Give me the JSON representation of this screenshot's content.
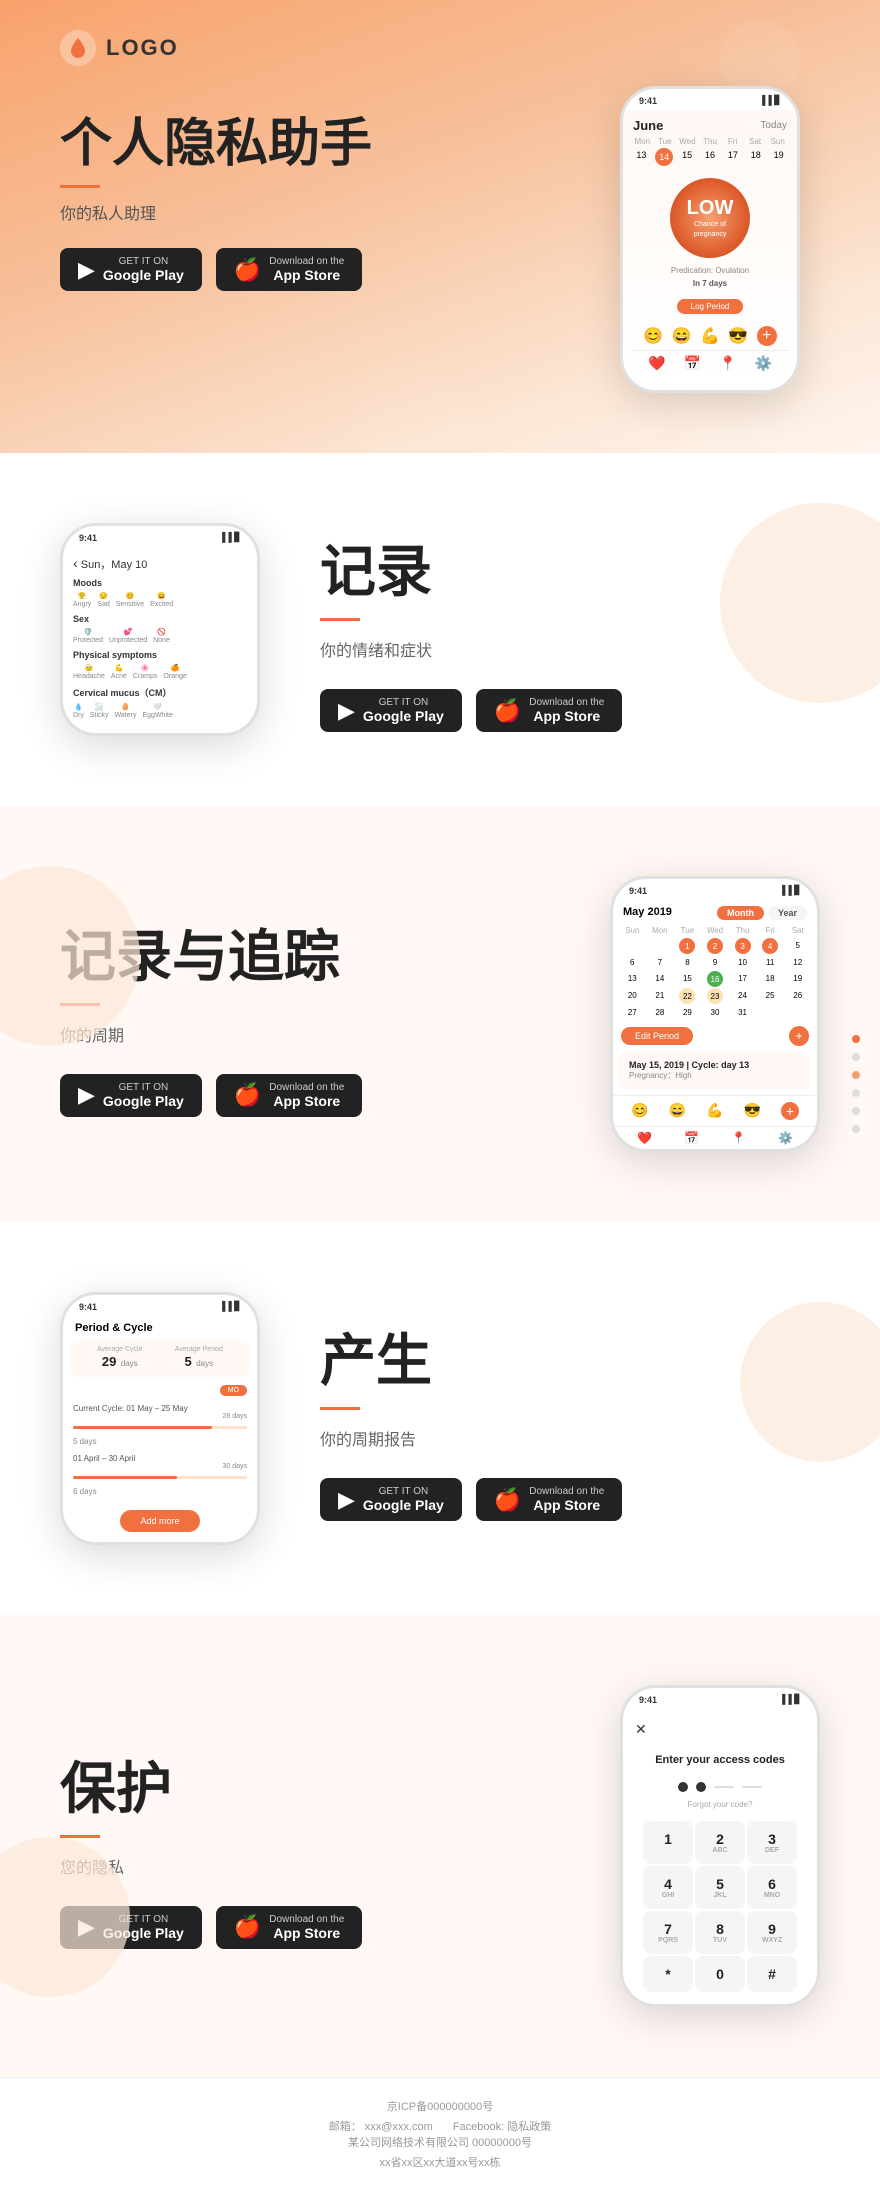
{
  "logo": {
    "text": "LOGO"
  },
  "hero": {
    "title": "个人隐私助手",
    "subtitle": "你的私人助理",
    "google_play_label_small": "GET IT ON",
    "google_play_label": "Google Play",
    "app_store_label_small": "Download on the",
    "app_store_label": "App Store"
  },
  "section1": {
    "title": "记录",
    "subtitle": "你的情绪和症状",
    "google_play_label_small": "GET IT ON",
    "google_play_label": "Google Play",
    "app_store_label_small": "Download on the",
    "app_store_label": "App Store",
    "phone": {
      "date": "Sun，May 10",
      "moods_label": "Moods",
      "sex_label": "Sex",
      "physical_label": "Physical symptoms",
      "mucus_label": "Cervical mucus（CM）"
    }
  },
  "section2": {
    "title": "记录与追踪",
    "subtitle": "你的周期",
    "google_play_label_small": "GET IT ON",
    "google_play_label": "Google Play",
    "app_store_label_small": "Download on the",
    "app_store_label": "App Store",
    "phone": {
      "month": "May 2019",
      "period_info": "May 15, 2019 | Cycle: day 13",
      "pregnancy": "Pregnancy：High",
      "edit_btn": "Edit Period"
    }
  },
  "section3": {
    "title": "产生",
    "subtitle": "你的周期报告",
    "google_play_label_small": "GET IT ON",
    "google_play_label": "Google Play",
    "app_store_label_small": "Download on the",
    "app_store_label": "App Store",
    "phone": {
      "header": "Period & Cycle",
      "avg_cycle_label": "Average Cycle",
      "avg_cycle_value": "29 days",
      "avg_period_label": "Average Period",
      "avg_period_value": "5 days",
      "current_label": "Current Cycle: 01 May – 25 May",
      "current_days": "28 days",
      "item1_label": "5 days",
      "item2_label": "01 April – 30 April",
      "item2_days": "30 days",
      "item3_label": "6 days",
      "add_more": "Add more"
    }
  },
  "section4": {
    "title": "保护",
    "subtitle": "您的隐私",
    "google_play_label_small": "GET IT ON",
    "google_play_label": "Google Play",
    "app_store_label_small": "Download on the",
    "app_store_label": "App Store",
    "phone": {
      "access_title": "Enter your access codes",
      "forgot": "Forgot your code?",
      "keys": [
        "1",
        "2",
        "3",
        "4",
        "5",
        "6",
        "7",
        "8",
        "9",
        "*",
        "0",
        "#"
      ],
      "sub_keys": [
        "",
        "ABC",
        "DEF",
        "GHI",
        "JKL",
        "MNO",
        "PQRS",
        "TUV",
        "WXYZ",
        "",
        "",
        ""
      ]
    }
  },
  "footer": {
    "icp": "京ICP备000000000号",
    "email_label": "邮箱：",
    "email": "xxx@xxx.com",
    "facebook_label": "Facebook:",
    "facebook": "隐私政策",
    "company": "某公司网络技术有限公司 00000000号",
    "address": "xx省xx区xx大道xx号xx栋"
  },
  "nav_dots": [
    {
      "active": true
    },
    {
      "active": false
    },
    {
      "active": false
    },
    {
      "active": false
    },
    {
      "active": false
    },
    {
      "active": false
    }
  ]
}
